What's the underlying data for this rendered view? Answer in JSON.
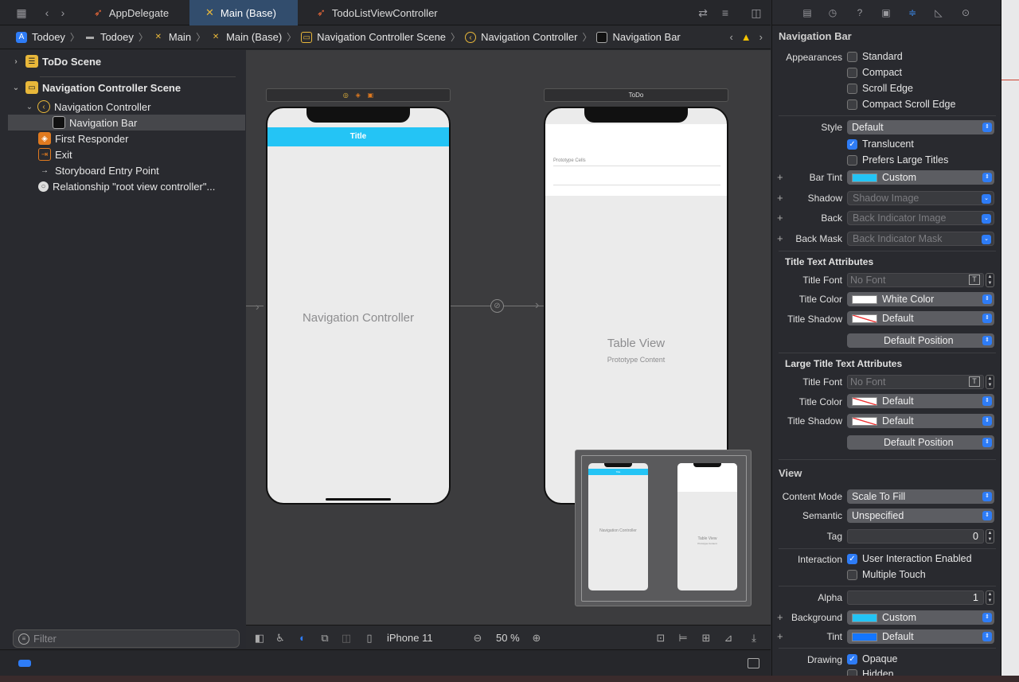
{
  "tabs": [
    {
      "label": "AppDelegate",
      "icon": "swift-file-icon",
      "active": false
    },
    {
      "label": "Main (Base)",
      "icon": "storyboard-icon",
      "active": true
    },
    {
      "label": "TodoListViewController",
      "icon": "swift-file-icon",
      "active": false
    }
  ],
  "breadcrumb": [
    "Todoey",
    "Todoey",
    "Main",
    "Main (Base)",
    "Navigation Controller Scene",
    "Navigation Controller",
    "Navigation Bar"
  ],
  "outline": {
    "todo_scene": "ToDo Scene",
    "nav_scene": "Navigation Controller Scene",
    "nav_controller": "Navigation Controller",
    "nav_bar": "Navigation Bar",
    "first_responder": "First Responder",
    "exit": "Exit",
    "entry_point": "Storyboard Entry Point",
    "relationship": "Relationship \"root view controller\"..."
  },
  "filter": {
    "placeholder": "Filter"
  },
  "canvas": {
    "nav_phone": {
      "bar_title": "Title",
      "label": "Navigation Controller"
    },
    "todo_scene_bar": "ToDo",
    "table_phone": {
      "prototype_cells": "Prototype Cells",
      "label": "Table View",
      "sublabel": "Prototype Content"
    },
    "minimap": {
      "nav_label": "Navigation Controller",
      "table_label": "Table View",
      "table_sub": "Prototype Content",
      "bar_title": "Title"
    }
  },
  "canvas_toolbar": {
    "device": "iPhone 11",
    "zoom": "50 %"
  },
  "inspector": {
    "title": "Navigation Bar",
    "appearances_label": "Appearances",
    "appearances": [
      {
        "label": "Standard",
        "checked": false
      },
      {
        "label": "Compact",
        "checked": false
      },
      {
        "label": "Scroll Edge",
        "checked": false
      },
      {
        "label": "Compact Scroll Edge",
        "checked": false
      }
    ],
    "style_label": "Style",
    "style": "Default",
    "translucent": "Translucent",
    "large_titles": "Prefers Large Titles",
    "bar_tint_label": "Bar Tint",
    "bar_tint": "Custom",
    "shadow_label": "Shadow",
    "shadow_placeholder": "Shadow Image",
    "back_label": "Back",
    "back_placeholder": "Back Indicator Image",
    "back_mask_label": "Back Mask",
    "back_mask_placeholder": "Back Indicator Mask",
    "title_text_attrs": "Title Text Attributes",
    "title_font_label": "Title Font",
    "title_font": "No Font",
    "title_color_label": "Title Color",
    "title_color": "White Color",
    "title_shadow_label": "Title Shadow",
    "title_shadow": "Default",
    "title_position": "Default Position",
    "large_title_attrs": "Large Title Text Attributes",
    "lt_font_label": "Title Font",
    "lt_font": "No Font",
    "lt_color_label": "Title Color",
    "lt_color": "Default",
    "lt_shadow_label": "Title Shadow",
    "lt_shadow": "Default",
    "lt_position": "Default Position",
    "view_title": "View",
    "content_mode_label": "Content Mode",
    "content_mode": "Scale To Fill",
    "semantic_label": "Semantic",
    "semantic": "Unspecified",
    "tag_label": "Tag",
    "tag": "0",
    "interaction_label": "Interaction",
    "user_interaction": "User Interaction Enabled",
    "multiple_touch": "Multiple Touch",
    "alpha_label": "Alpha",
    "alpha": "1",
    "background_label": "Background",
    "background": "Custom",
    "tint_label": "Tint",
    "tint": "Default",
    "drawing_label": "Drawing",
    "opaque": "Opaque",
    "hidden": "Hidden"
  },
  "colors": {
    "accent": "#2e7cf6",
    "nav_bar": "#24c4f5",
    "warning": "#f5c300"
  }
}
